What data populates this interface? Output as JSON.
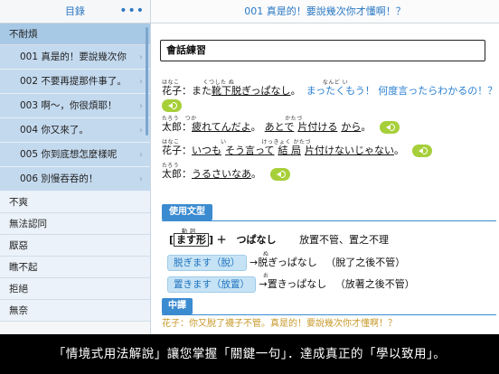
{
  "sidebar": {
    "title": "目錄",
    "more_icon": "•••",
    "categories": [
      {
        "label": "不耐煩"
      },
      {
        "label": "不爽"
      },
      {
        "label": "無法認同"
      },
      {
        "label": "厭惡"
      },
      {
        "label": "瞧不起"
      },
      {
        "label": "拒絕"
      },
      {
        "label": "無奈"
      }
    ],
    "items": [
      {
        "label": "001 真是的！要說幾次你",
        "chevron": "›"
      },
      {
        "label": "002 不要再提那件事了。",
        "chevron": "›"
      },
      {
        "label": "003 啊～，你很煩耶！",
        "chevron": "›"
      },
      {
        "label": "004 你又來了。",
        "chevron": "›"
      },
      {
        "label": "005 你到底想怎麼樣呢",
        "chevron": "›"
      },
      {
        "label": "006 別慢吞吞的！",
        "chevron": "›"
      }
    ]
  },
  "main": {
    "title": "001 真是的！要說幾次你才懂啊！？",
    "practice_title": "會話練習",
    "dialogue": [
      {
        "furigana": "はなこ　　　　くつした ぬ　　　　　　　　　　　　　　　なんど い",
        "speaker": "花子：",
        "a": "また",
        "b": "靴下脱ぎっぱなし",
        "c": "。",
        "d": "まったくもう！ 何度言ったらわかるの！？"
      },
      {
        "furigana": "たろう",
        "speaker": "太郎：",
        "text": ""
      },
      {
        "furigana": "たろう　つか　　　　　　　　　　　　　　　かたづ",
        "speaker": "太郎：",
        "a": "疲れてんだよ",
        "b": "。",
        "c": "あとで",
        "d": "片付ける",
        "e": "から",
        "f": "。"
      },
      {
        "furigana": "はなこ　　　　　　　い　　　　　　けっきょく かたづ",
        "speaker": "花子：",
        "a": "いつも",
        "b": "そう言って",
        "c": "結 局",
        "d": "片付けないじゃない",
        "e": "。"
      },
      {
        "furigana": "たろう",
        "speaker": "太郎：",
        "a": "うるさいなあ",
        "b": "。"
      }
    ],
    "grammar_tab": "使用文型",
    "grammar_pattern_tag": "ます形",
    "grammar_pattern_tag_furi": "動 詞",
    "grammar_pattern": "＋　つぱなし",
    "grammar_meaning": "放置不管、置之不理",
    "examples": [
      {
        "pill": "脱ぎます（脫）",
        "arrow": "→",
        "result": "脱ぎっぱなし",
        "furi": "ぬ",
        "meaning": "（脫了之後不管）"
      },
      {
        "pill": "置きます（放置）",
        "arrow": "→",
        "result": "置きっぱなし",
        "furi": "お",
        "meaning": "（放著之後不管）"
      }
    ],
    "translation_tab": "中譯",
    "translation_line": "花子：你又脫了襪子不管。真是的！要說幾次你才懂啊！？"
  },
  "caption": "「情境式用法解說」讓您掌握「關鍵一句」．達成真正的「學以致用」。",
  "colors": {
    "accent": "#2a78c2",
    "speaker_icon": "#a7cf3a",
    "band": "#000000"
  }
}
